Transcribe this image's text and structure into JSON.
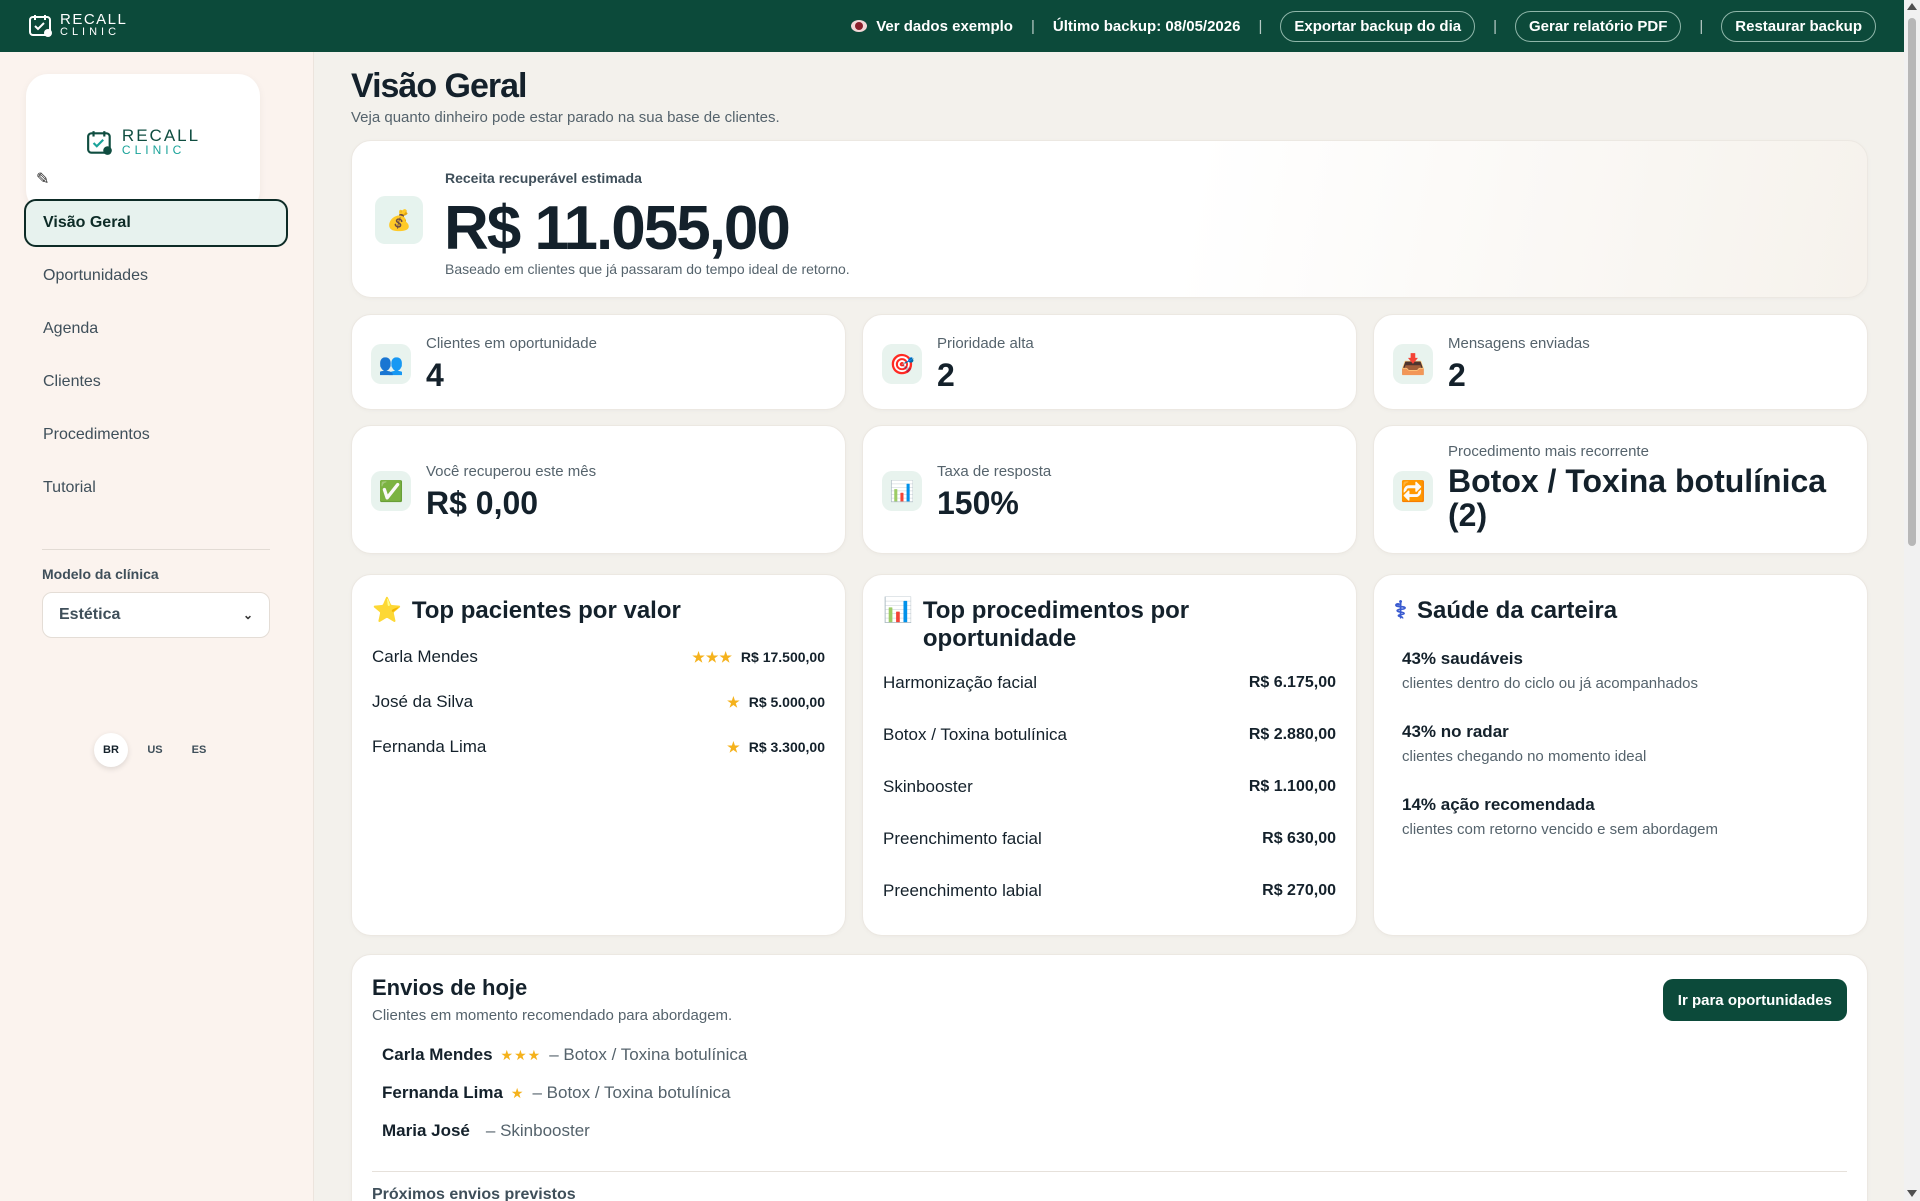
{
  "topbar": {
    "logo_line1": "RECALL",
    "logo_line2": "CLINIC",
    "sample_data": "Ver dados exemplo",
    "last_backup": "Último backup: 08/05/2026",
    "export_btn": "Exportar backup do dia",
    "pdf_btn": "Gerar relatório PDF",
    "restore_btn": "Restaurar backup"
  },
  "sidebar": {
    "logo_line1": "RECALL",
    "logo_line2": "CLINIC",
    "items": [
      {
        "label": "Visão Geral"
      },
      {
        "label": "Oportunidades"
      },
      {
        "label": "Agenda"
      },
      {
        "label": "Clientes"
      },
      {
        "label": "Procedimentos"
      },
      {
        "label": "Tutorial"
      }
    ],
    "model_label": "Modelo da clínica",
    "model_value": "Estética",
    "languages": [
      "BR",
      "US",
      "ES"
    ]
  },
  "page": {
    "title": "Visão Geral",
    "subtitle": "Veja quanto dinheiro pode estar parado na sua base de clientes."
  },
  "hero": {
    "label": "Receita recuperável estimada",
    "value": "R$ 11.055,00",
    "note": "Baseado em clientes que já passaram do tempo ideal de retorno."
  },
  "stats": [
    {
      "label": "Clientes em oportunidade",
      "value": "4",
      "icon": "people-icon"
    },
    {
      "label": "Prioridade alta",
      "value": "2",
      "icon": "target-icon"
    },
    {
      "label": "Mensagens enviadas",
      "value": "2",
      "icon": "inbox-icon"
    },
    {
      "label": "Você recuperou este mês",
      "value": "R$ 0,00",
      "icon": "check-icon"
    },
    {
      "label": "Taxa de resposta",
      "value": "150%",
      "icon": "bar-chart-icon"
    },
    {
      "label": "Procedimento mais recorrente",
      "value": "Botox / Toxina botulínica (2)",
      "icon": "repeat-icon"
    }
  ],
  "top_patients": {
    "title": "Top pacientes por valor",
    "rows": [
      {
        "name": "Carla Mendes",
        "stars": "★★★",
        "value": "R$ 17.500,00"
      },
      {
        "name": "José da Silva",
        "stars": "★",
        "value": "R$ 5.000,00"
      },
      {
        "name": "Fernanda Lima",
        "stars": "★",
        "value": "R$ 3.300,00"
      }
    ]
  },
  "top_procedures": {
    "title": "Top procedimentos por oportunidade",
    "rows": [
      {
        "name": "Harmonização facial",
        "value": "R$ 6.175,00"
      },
      {
        "name": "Botox / Toxina botulínica",
        "value": "R$ 2.880,00"
      },
      {
        "name": "Skinbooster",
        "value": "R$ 1.100,00"
      },
      {
        "name": "Preenchimento facial",
        "value": "R$ 630,00"
      },
      {
        "name": "Preenchimento labial",
        "value": "R$ 270,00"
      }
    ]
  },
  "health": {
    "title": "Saúde da carteira",
    "items": [
      {
        "head": "43% saudáveis",
        "desc": "clientes dentro do ciclo ou já acompanhados"
      },
      {
        "head": "43% no radar",
        "desc": "clientes chegando no momento ideal"
      },
      {
        "head": "14% ação recomendada",
        "desc": "clientes com retorno vencido e sem abordagem"
      }
    ]
  },
  "envios": {
    "title": "Envios de hoje",
    "subtitle": "Clientes em momento recomendado para abordagem.",
    "button": "Ir para oportunidades",
    "rows": [
      {
        "name": "Carla Mendes",
        "stars": "★★★",
        "proc": "– Botox / Toxina botulínica"
      },
      {
        "name": "Fernanda Lima",
        "stars": "★",
        "proc": "– Botox / Toxina botulínica"
      },
      {
        "name": "Maria José",
        "stars": "",
        "proc": "– Skinbooster"
      }
    ],
    "next_title": "Próximos envios previstos"
  }
}
